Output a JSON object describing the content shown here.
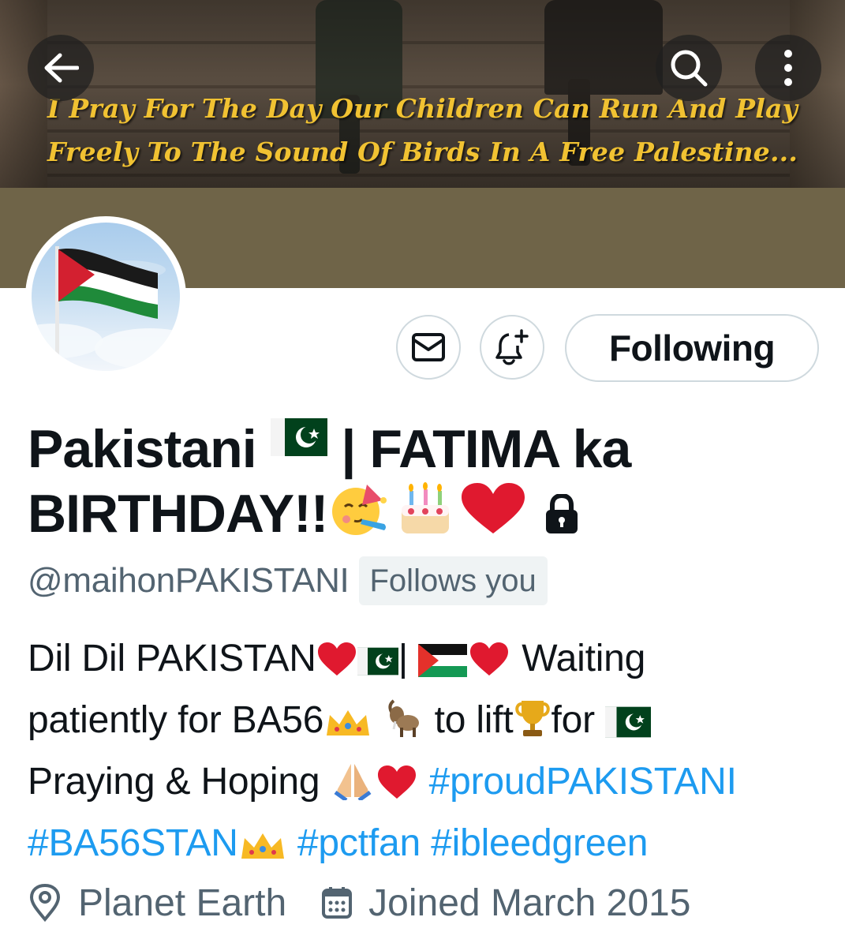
{
  "banner": {
    "caption_line1": "I Pray For The Day Our Children Can Run And Play",
    "caption_line2": "Freely To The Sound Of Birds In A Free Palestine..."
  },
  "header": {
    "back_icon": "arrow-left-icon",
    "search_icon": "search-icon",
    "more_icon": "more-vertical-icon"
  },
  "avatar": {
    "description_icon": "palestine-flag"
  },
  "actions": {
    "message_icon": "envelope-icon",
    "notify_icon": "bell-plus-icon",
    "following_label": "Following"
  },
  "profile": {
    "name_part1": "Pakistani",
    "name_part2": "| FATIMA ka",
    "name_part3": "BIRTHDAY!!",
    "handle": "@maihonPAKISTANI",
    "follows_you": "Follows you",
    "protected_icon": "lock-icon"
  },
  "bio": {
    "t1": "Dil Dil PAKISTAN",
    "t2": "|",
    "t3": "Waiting",
    "t4": "patiently for BA56",
    "t5": "to lift",
    "t6": "for",
    "t7": "Praying & Hoping",
    "hashtags": [
      "#proudPAKISTANI",
      "#BA56STAN",
      "#pctfan",
      "#ibleedgreen"
    ]
  },
  "meta": {
    "location": "Planet Earth",
    "joined": "Joined March 2015",
    "location_icon": "location-pin-icon",
    "calendar_icon": "calendar-icon"
  },
  "colors": {
    "link": "#1d9bf0",
    "secondary_text": "#536471",
    "banner_caption": "#f1c232",
    "banner_bottom": "#6f6448"
  }
}
